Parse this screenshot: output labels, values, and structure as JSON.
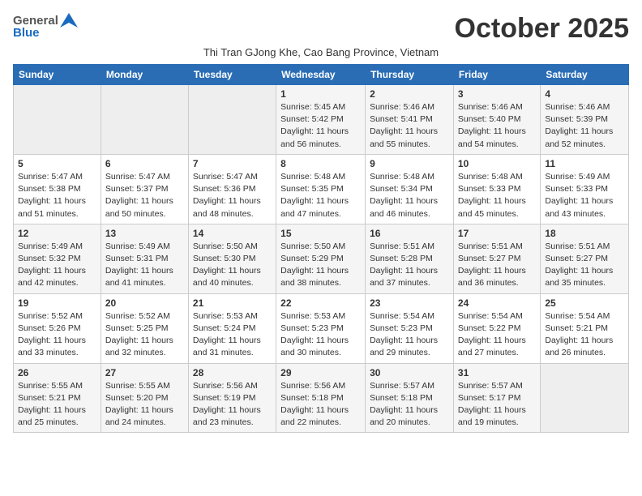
{
  "header": {
    "logo_general": "General",
    "logo_blue": "Blue",
    "month_title": "October 2025",
    "subtitle": "Thi Tran GJong Khe, Cao Bang Province, Vietnam"
  },
  "weekdays": [
    "Sunday",
    "Monday",
    "Tuesday",
    "Wednesday",
    "Thursday",
    "Friday",
    "Saturday"
  ],
  "weeks": [
    [
      {
        "day": "",
        "info": ""
      },
      {
        "day": "",
        "info": ""
      },
      {
        "day": "",
        "info": ""
      },
      {
        "day": "1",
        "info": "Sunrise: 5:45 AM\nSunset: 5:42 PM\nDaylight: 11 hours\nand 56 minutes."
      },
      {
        "day": "2",
        "info": "Sunrise: 5:46 AM\nSunset: 5:41 PM\nDaylight: 11 hours\nand 55 minutes."
      },
      {
        "day": "3",
        "info": "Sunrise: 5:46 AM\nSunset: 5:40 PM\nDaylight: 11 hours\nand 54 minutes."
      },
      {
        "day": "4",
        "info": "Sunrise: 5:46 AM\nSunset: 5:39 PM\nDaylight: 11 hours\nand 52 minutes."
      }
    ],
    [
      {
        "day": "5",
        "info": "Sunrise: 5:47 AM\nSunset: 5:38 PM\nDaylight: 11 hours\nand 51 minutes."
      },
      {
        "day": "6",
        "info": "Sunrise: 5:47 AM\nSunset: 5:37 PM\nDaylight: 11 hours\nand 50 minutes."
      },
      {
        "day": "7",
        "info": "Sunrise: 5:47 AM\nSunset: 5:36 PM\nDaylight: 11 hours\nand 48 minutes."
      },
      {
        "day": "8",
        "info": "Sunrise: 5:48 AM\nSunset: 5:35 PM\nDaylight: 11 hours\nand 47 minutes."
      },
      {
        "day": "9",
        "info": "Sunrise: 5:48 AM\nSunset: 5:34 PM\nDaylight: 11 hours\nand 46 minutes."
      },
      {
        "day": "10",
        "info": "Sunrise: 5:48 AM\nSunset: 5:33 PM\nDaylight: 11 hours\nand 45 minutes."
      },
      {
        "day": "11",
        "info": "Sunrise: 5:49 AM\nSunset: 5:33 PM\nDaylight: 11 hours\nand 43 minutes."
      }
    ],
    [
      {
        "day": "12",
        "info": "Sunrise: 5:49 AM\nSunset: 5:32 PM\nDaylight: 11 hours\nand 42 minutes."
      },
      {
        "day": "13",
        "info": "Sunrise: 5:49 AM\nSunset: 5:31 PM\nDaylight: 11 hours\nand 41 minutes."
      },
      {
        "day": "14",
        "info": "Sunrise: 5:50 AM\nSunset: 5:30 PM\nDaylight: 11 hours\nand 40 minutes."
      },
      {
        "day": "15",
        "info": "Sunrise: 5:50 AM\nSunset: 5:29 PM\nDaylight: 11 hours\nand 38 minutes."
      },
      {
        "day": "16",
        "info": "Sunrise: 5:51 AM\nSunset: 5:28 PM\nDaylight: 11 hours\nand 37 minutes."
      },
      {
        "day": "17",
        "info": "Sunrise: 5:51 AM\nSunset: 5:27 PM\nDaylight: 11 hours\nand 36 minutes."
      },
      {
        "day": "18",
        "info": "Sunrise: 5:51 AM\nSunset: 5:27 PM\nDaylight: 11 hours\nand 35 minutes."
      }
    ],
    [
      {
        "day": "19",
        "info": "Sunrise: 5:52 AM\nSunset: 5:26 PM\nDaylight: 11 hours\nand 33 minutes."
      },
      {
        "day": "20",
        "info": "Sunrise: 5:52 AM\nSunset: 5:25 PM\nDaylight: 11 hours\nand 32 minutes."
      },
      {
        "day": "21",
        "info": "Sunrise: 5:53 AM\nSunset: 5:24 PM\nDaylight: 11 hours\nand 31 minutes."
      },
      {
        "day": "22",
        "info": "Sunrise: 5:53 AM\nSunset: 5:23 PM\nDaylight: 11 hours\nand 30 minutes."
      },
      {
        "day": "23",
        "info": "Sunrise: 5:54 AM\nSunset: 5:23 PM\nDaylight: 11 hours\nand 29 minutes."
      },
      {
        "day": "24",
        "info": "Sunrise: 5:54 AM\nSunset: 5:22 PM\nDaylight: 11 hours\nand 27 minutes."
      },
      {
        "day": "25",
        "info": "Sunrise: 5:54 AM\nSunset: 5:21 PM\nDaylight: 11 hours\nand 26 minutes."
      }
    ],
    [
      {
        "day": "26",
        "info": "Sunrise: 5:55 AM\nSunset: 5:21 PM\nDaylight: 11 hours\nand 25 minutes."
      },
      {
        "day": "27",
        "info": "Sunrise: 5:55 AM\nSunset: 5:20 PM\nDaylight: 11 hours\nand 24 minutes."
      },
      {
        "day": "28",
        "info": "Sunrise: 5:56 AM\nSunset: 5:19 PM\nDaylight: 11 hours\nand 23 minutes."
      },
      {
        "day": "29",
        "info": "Sunrise: 5:56 AM\nSunset: 5:18 PM\nDaylight: 11 hours\nand 22 minutes."
      },
      {
        "day": "30",
        "info": "Sunrise: 5:57 AM\nSunset: 5:18 PM\nDaylight: 11 hours\nand 20 minutes."
      },
      {
        "day": "31",
        "info": "Sunrise: 5:57 AM\nSunset: 5:17 PM\nDaylight: 11 hours\nand 19 minutes."
      },
      {
        "day": "",
        "info": ""
      }
    ]
  ]
}
